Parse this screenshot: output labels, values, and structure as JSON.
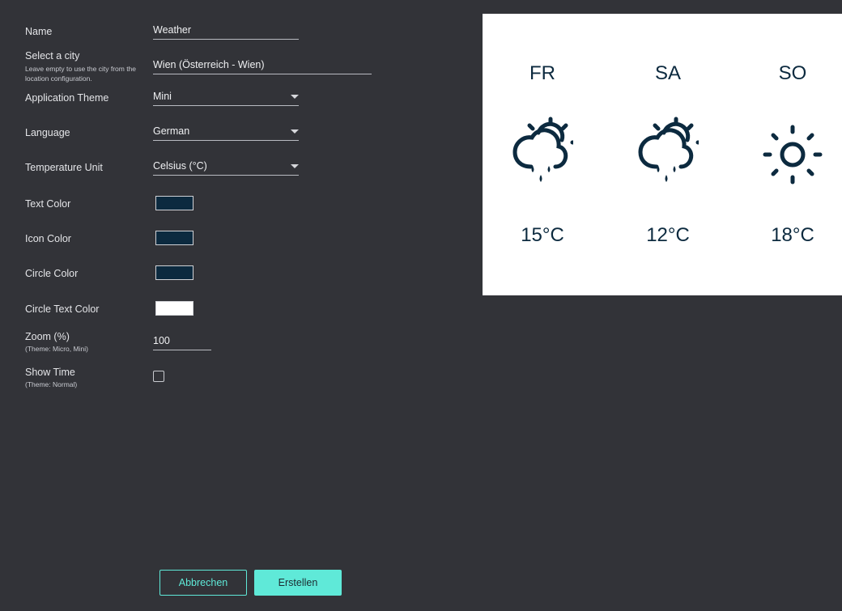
{
  "form": {
    "name": {
      "label": "Name",
      "value": "Weather"
    },
    "city": {
      "label": "Select a city",
      "hint": "Leave empty to use the city from the location configuration.",
      "value": "Wien (Österreich - Wien)"
    },
    "theme": {
      "label": "Application Theme",
      "value": "Mini"
    },
    "language": {
      "label": "Language",
      "value": "German"
    },
    "temp_unit": {
      "label": "Temperature Unit",
      "value": "Celsius (°C)"
    },
    "text_color": {
      "label": "Text Color",
      "color": "#0c2a3f"
    },
    "icon_color": {
      "label": "Icon Color",
      "color": "#0c2a3f"
    },
    "circle_color": {
      "label": "Circle Color",
      "color": "#0c2a3f"
    },
    "circle_text_color": {
      "label": "Circle Text Color",
      "color": "#ffffff"
    },
    "zoom": {
      "label": "Zoom (%)",
      "hint": "(Theme: Micro, Mini)",
      "value": "100"
    },
    "show_time": {
      "label": "Show Time",
      "hint": "(Theme: Normal)",
      "checked": false
    }
  },
  "preview": {
    "days": [
      {
        "name": "FR",
        "icon": "cloud-sun-rain-icon",
        "temp": "15°C"
      },
      {
        "name": "SA",
        "icon": "cloud-sun-rain-icon",
        "temp": "12°C"
      },
      {
        "name": "SO",
        "icon": "sun-icon",
        "temp": "18°C"
      }
    ],
    "icon_color": "#0c2a3f",
    "background": "#ffffff"
  },
  "buttons": {
    "cancel_label": "Abbrechen",
    "create_label": "Erstellen"
  },
  "colors": {
    "background": "#323338",
    "accent": "#5fe9d8"
  }
}
